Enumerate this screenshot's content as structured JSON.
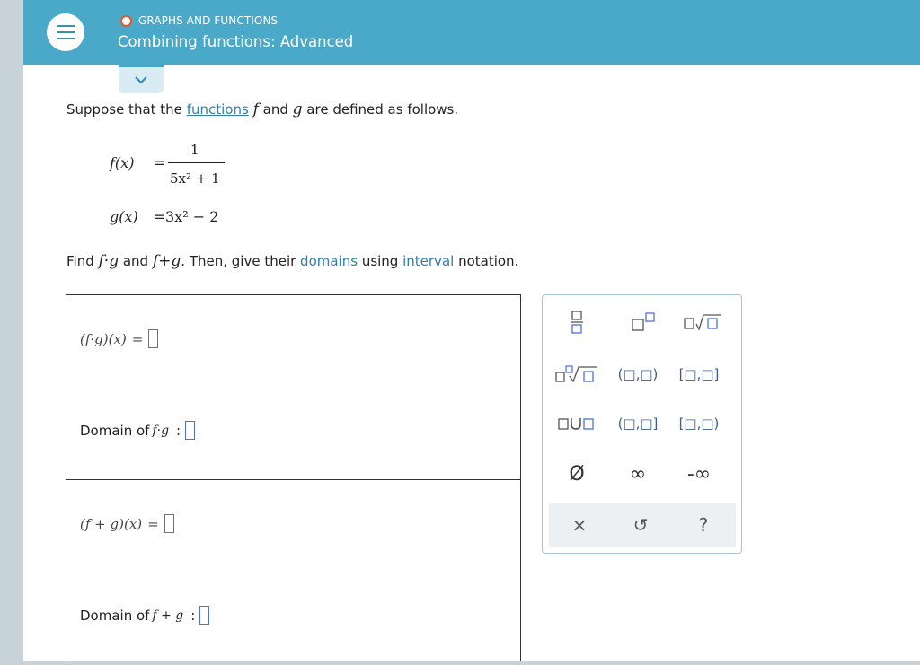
{
  "header": {
    "topic": "GRAPHS AND FUNCTIONS",
    "title": "Combining functions: Advanced"
  },
  "problem": {
    "intro_1": "Suppose that the ",
    "intro_link": "functions",
    "intro_f": "f",
    "intro_2": "and ",
    "intro_g": "g",
    "intro_3": " are defined as follows.",
    "f_lhs": "f(x)",
    "f_eq": "=",
    "f_num": "1",
    "f_den": "5x² + 1",
    "g_lhs": "g(x)",
    "g_eq": "=",
    "g_rhs": "3x² − 2",
    "find_1": "Find ",
    "find_fg": "f·g",
    "find_and": " and ",
    "find_fpg": "f+g",
    "find_2": ". Then, give their ",
    "link_domains": "domains",
    "find_3": " using ",
    "link_interval": "interval",
    "find_4": " notation."
  },
  "answers": {
    "product_expr": "(f·g)(x)",
    "sum_expr": "(f + g)(x)",
    "eq": "=",
    "domain_product_label": "Domain of ",
    "domain_product_fn": "f·g",
    "domain_sum_label": "Domain of ",
    "domain_sum_fn": "f + g",
    "colon": ":"
  },
  "palette": {
    "open_open": "(□,□)",
    "closed_closed": "[□,□]",
    "open_closed": "(□,□]",
    "closed_open": "[□,□)",
    "union": "∪",
    "empty_set": "Ø",
    "infinity": "∞",
    "neg_infinity": "-∞",
    "clear": "×",
    "undo": "↺",
    "help": "?"
  },
  "colors": {
    "header_bg": "#4aa9c8",
    "link": "#2f7fa6",
    "slot_border": "#4e6fd9",
    "topic_dot": "#e8572f"
  }
}
